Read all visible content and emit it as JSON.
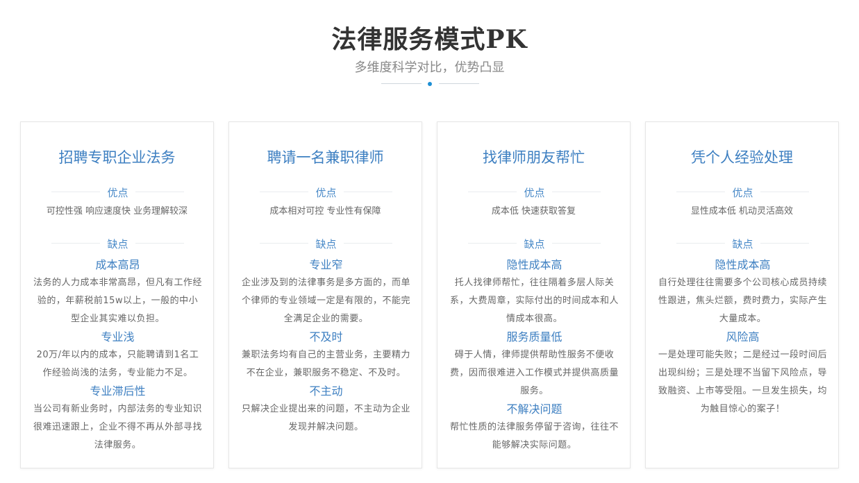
{
  "header": {
    "title": "法律服务模式PK",
    "subtitle": "多维度科学对比，优势凸显"
  },
  "colors": {
    "accent": "#3d7fc1",
    "dot": "#1e8fd4"
  },
  "cards": [
    {
      "title": "招聘专职企业法务",
      "pros_label": "优点",
      "pros": "可控性强  响应速度快  业务理解较深",
      "cons_label": "缺点",
      "cons": [
        {
          "title": "成本高昂",
          "desc": "法务的人力成本非常高昂，但凡有工作经验的，年薪税前15w以上，一般的中小型企业其实难以负担。"
        },
        {
          "title": "专业浅",
          "desc": "20万/年以内的成本，只能聘请到1名工作经验尚浅的法务，专业能力不足。"
        },
        {
          "title": "专业滞后性",
          "desc": "当公司有新业务时，内部法务的专业知识很难迅速跟上，企业不得不再从外部寻找法律服务。"
        }
      ]
    },
    {
      "title": "聘请一名兼职律师",
      "pros_label": "优点",
      "pros": "成本相对可控  专业性有保障",
      "cons_label": "缺点",
      "cons": [
        {
          "title": "专业窄",
          "desc": "企业涉及到的法律事务是多方面的，而单个律师的专业领域一定是有限的，不能完全满足企业的需要。"
        },
        {
          "title": "不及时",
          "desc": "兼职法务均有自己的主营业务，主要精力不在企业，兼职服务不稳定、不及时。"
        },
        {
          "title": "不主动",
          "desc": "只解决企业提出来的问题，不主动为企业发现并解决问题。"
        }
      ]
    },
    {
      "title": "找律师朋友帮忙",
      "pros_label": "优点",
      "pros": "成本低  快速获取答复",
      "cons_label": "缺点",
      "cons": [
        {
          "title": "隐性成本高",
          "desc": "托人找律师帮忙，往往隔着多层人际关系，大费周章，实际付出的时间成本和人情成本很高。"
        },
        {
          "title": "服务质量低",
          "desc": "碍于人情，律师提供帮助性服务不便收费，因而很难进入工作模式并提供高质量服务。"
        },
        {
          "title": "不解决问题",
          "desc": "帮忙性质的法律服务停留于咨询，往往不能够解决实际问题。"
        }
      ]
    },
    {
      "title": "凭个人经验处理",
      "pros_label": "优点",
      "pros": "显性成本低  机动灵活高效",
      "cons_label": "缺点",
      "cons": [
        {
          "title": "隐性成本高",
          "desc": "自行处理往往需要多个公司核心成员持续性跟进，焦头烂额，费时费力，实际产生大量成本。"
        },
        {
          "title": "风险高",
          "desc": "一是处理可能失败；二是经过一段时间后出现纠纷；三是处理不当留下风险点，导致融资、上市等受阻。一旦发生损失，均为触目惊心的案子！"
        }
      ]
    }
  ]
}
